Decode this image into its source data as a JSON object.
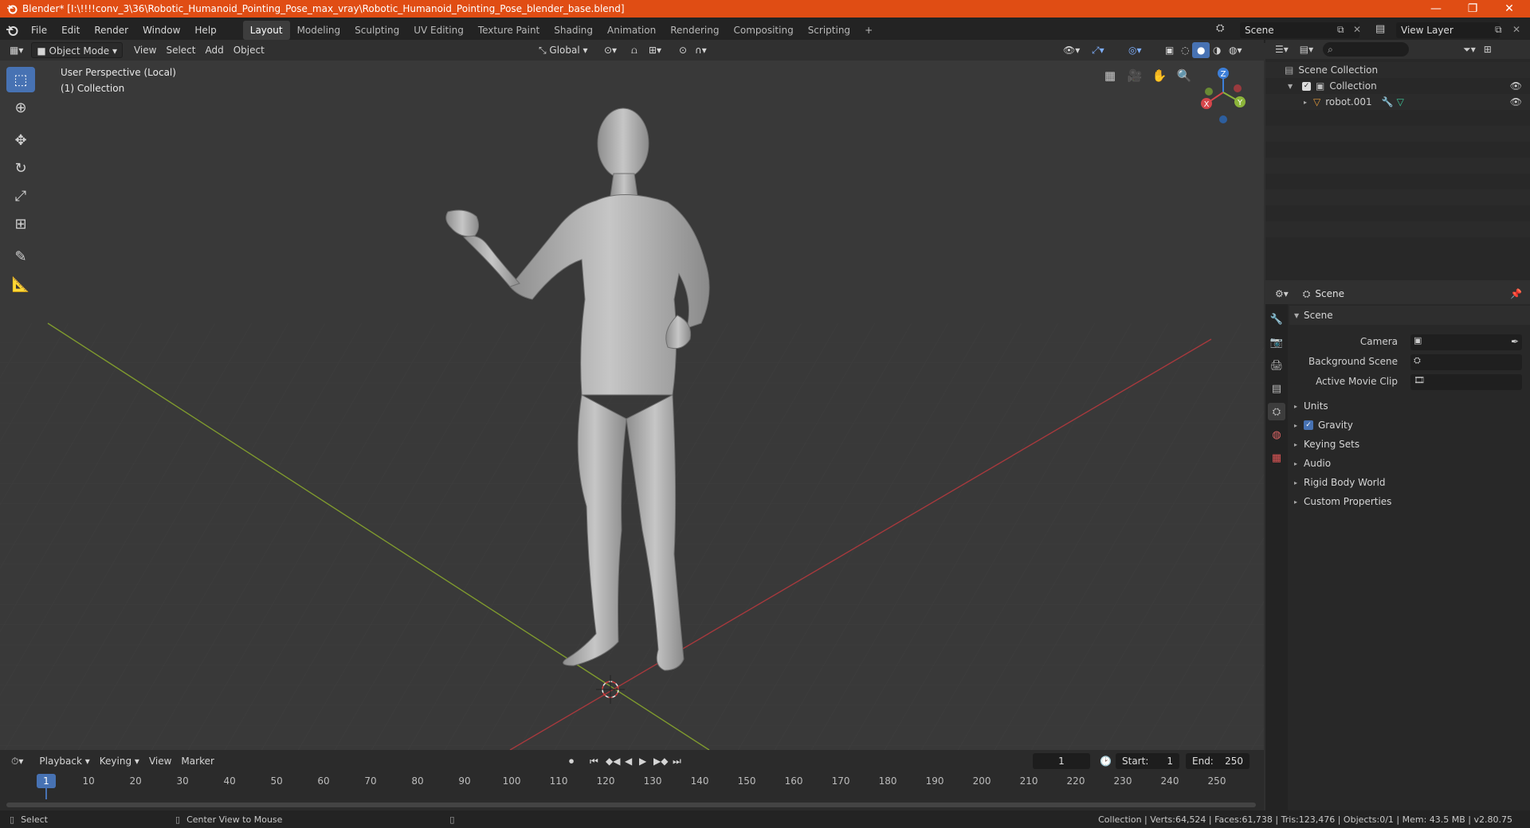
{
  "window": {
    "title": "Blender* [I:\\!!!!conv_3\\36\\Robotic_Humanoid_Pointing_Pose_max_vray\\Robotic_Humanoid_Pointing_Pose_blender_base.blend]"
  },
  "menus": [
    "File",
    "Edit",
    "Render",
    "Window",
    "Help"
  ],
  "workspaces": [
    "Layout",
    "Modeling",
    "Sculpting",
    "UV Editing",
    "Texture Paint",
    "Shading",
    "Animation",
    "Rendering",
    "Compositing",
    "Scripting"
  ],
  "active_workspace": "Layout",
  "scene_field": "Scene",
  "view_layer_field": "View Layer",
  "viewport_header": {
    "mode": "Object Mode",
    "menus": [
      "View",
      "Select",
      "Add",
      "Object"
    ],
    "orientation": "Global"
  },
  "viewport": {
    "perspective_label": "User Perspective (Local)",
    "collection_label": "(1) Collection",
    "gizmo": {
      "x": "X",
      "y": "Y",
      "z": "Z"
    }
  },
  "outliner": {
    "root": "Scene Collection",
    "collection": "Collection",
    "object": "robot.001"
  },
  "properties": {
    "context": "Scene",
    "section": "Scene",
    "fields": [
      {
        "label": "Camera"
      },
      {
        "label": "Background Scene"
      },
      {
        "label": "Active Movie Clip"
      }
    ],
    "panels": [
      "Units",
      "Gravity",
      "Keying Sets",
      "Audio",
      "Rigid Body World",
      "Custom Properties"
    ],
    "gravity_checked": true
  },
  "timeline": {
    "menus": [
      "Playback",
      "Keying",
      "View",
      "Marker"
    ],
    "current_frame": "1",
    "start_label": "Start:",
    "start": "1",
    "end_label": "End:",
    "end": "250",
    "ticks": [
      "1",
      "10",
      "20",
      "30",
      "40",
      "50",
      "60",
      "70",
      "80",
      "90",
      "100",
      "110",
      "120",
      "130",
      "140",
      "150",
      "160",
      "170",
      "180",
      "190",
      "200",
      "210",
      "220",
      "230",
      "240",
      "250"
    ]
  },
  "statusbar": {
    "left": "Select",
    "middle": "Center View to Mouse",
    "stats": "Collection | Verts:64,524 | Faces:61,738 | Tris:123,476 | Objects:0/1 | Mem: 43.5 MB | v2.80.75"
  },
  "colors": {
    "accent": "#4772b3",
    "titlebar": "#e04d14",
    "x_axis": "#d6464b",
    "y_axis": "#8cb43a",
    "z_axis": "#3d7fd9"
  }
}
